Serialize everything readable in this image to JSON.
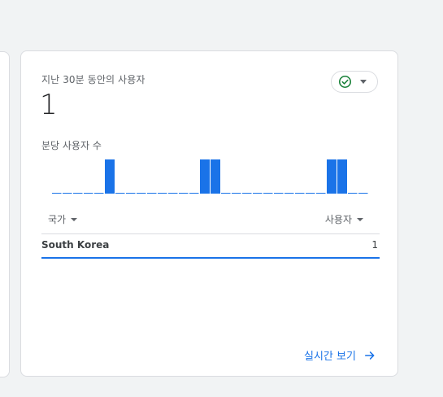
{
  "card": {
    "title": "지난 30분 동안의 사용자",
    "user_count": "1",
    "status_icon": "check-circle-icon",
    "chart_label": "분당 사용자 수",
    "table": {
      "headers": [
        "국가",
        "사용자"
      ],
      "rows": [
        {
          "country": "South Korea",
          "users": "1"
        }
      ]
    },
    "link_label": "실시간 보기",
    "link_icon": "arrow-right-icon"
  },
  "colors": {
    "accent": "#1a73e8",
    "success": "#188038",
    "baseline": "#1a73e8"
  },
  "chart_data": {
    "type": "bar",
    "title": "",
    "xlabel": "",
    "ylabel": "",
    "categories": [
      "1",
      "2",
      "3",
      "4",
      "5",
      "6",
      "7",
      "8",
      "9",
      "10",
      "11",
      "12",
      "13",
      "14",
      "15",
      "16",
      "17",
      "18",
      "19",
      "20",
      "21",
      "22",
      "23",
      "24",
      "25",
      "26",
      "27",
      "28",
      "29",
      "30"
    ],
    "values": [
      0,
      0,
      0,
      0,
      0,
      1,
      0,
      0,
      0,
      0,
      0,
      0,
      0,
      0,
      1,
      1,
      0,
      0,
      0,
      0,
      0,
      0,
      0,
      0,
      0,
      0,
      1,
      1,
      0,
      0
    ],
    "ylim": [
      0,
      1
    ],
    "grid": false,
    "legend": "none"
  }
}
